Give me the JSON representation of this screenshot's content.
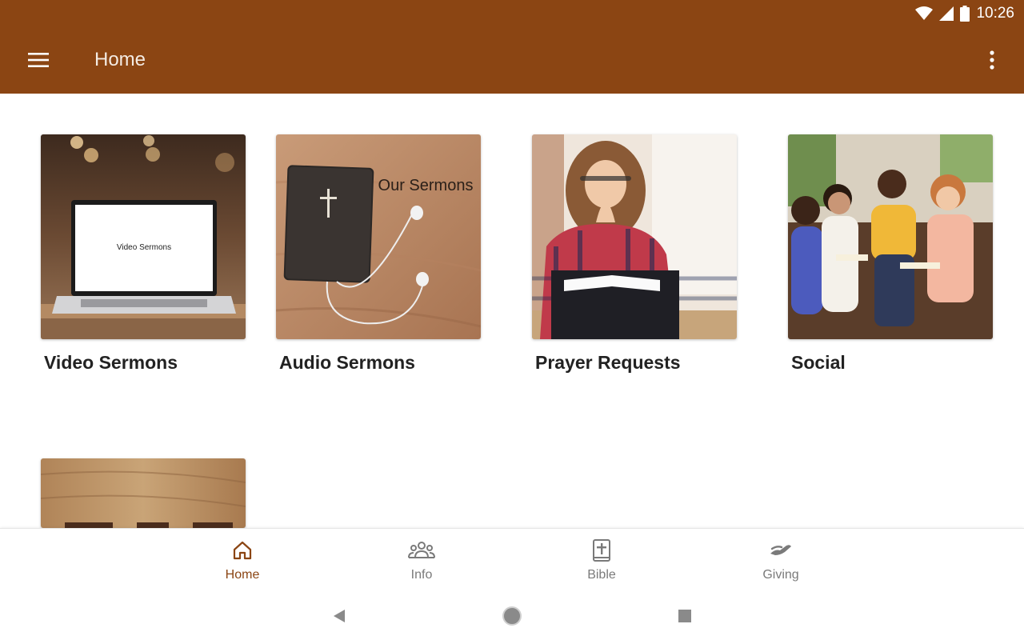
{
  "status_bar": {
    "time": "10:26",
    "icons": [
      "wifi-icon",
      "signal-icon",
      "battery-icon"
    ]
  },
  "app_bar": {
    "title": "Home",
    "menu_icon": "hamburger-menu-icon",
    "more_icon": "more-vert-icon",
    "color": "#8B4513"
  },
  "tiles": [
    {
      "label": "Video Sermons",
      "image_text": "Video Sermons"
    },
    {
      "label": "Audio Sermons",
      "image_text": "Our Sermons"
    },
    {
      "label": "Prayer Requests"
    },
    {
      "label": "Social"
    },
    {
      "label": ""
    }
  ],
  "bottom_nav": [
    {
      "label": "Home",
      "icon": "home-icon",
      "active": true
    },
    {
      "label": "Info",
      "icon": "people-icon",
      "active": false
    },
    {
      "label": "Bible",
      "icon": "bible-icon",
      "active": false
    },
    {
      "label": "Giving",
      "icon": "giving-hand-icon",
      "active": false
    }
  ],
  "colors": {
    "primary": "#8B4513",
    "inactive": "#7a7a7a",
    "label": "#222222"
  }
}
